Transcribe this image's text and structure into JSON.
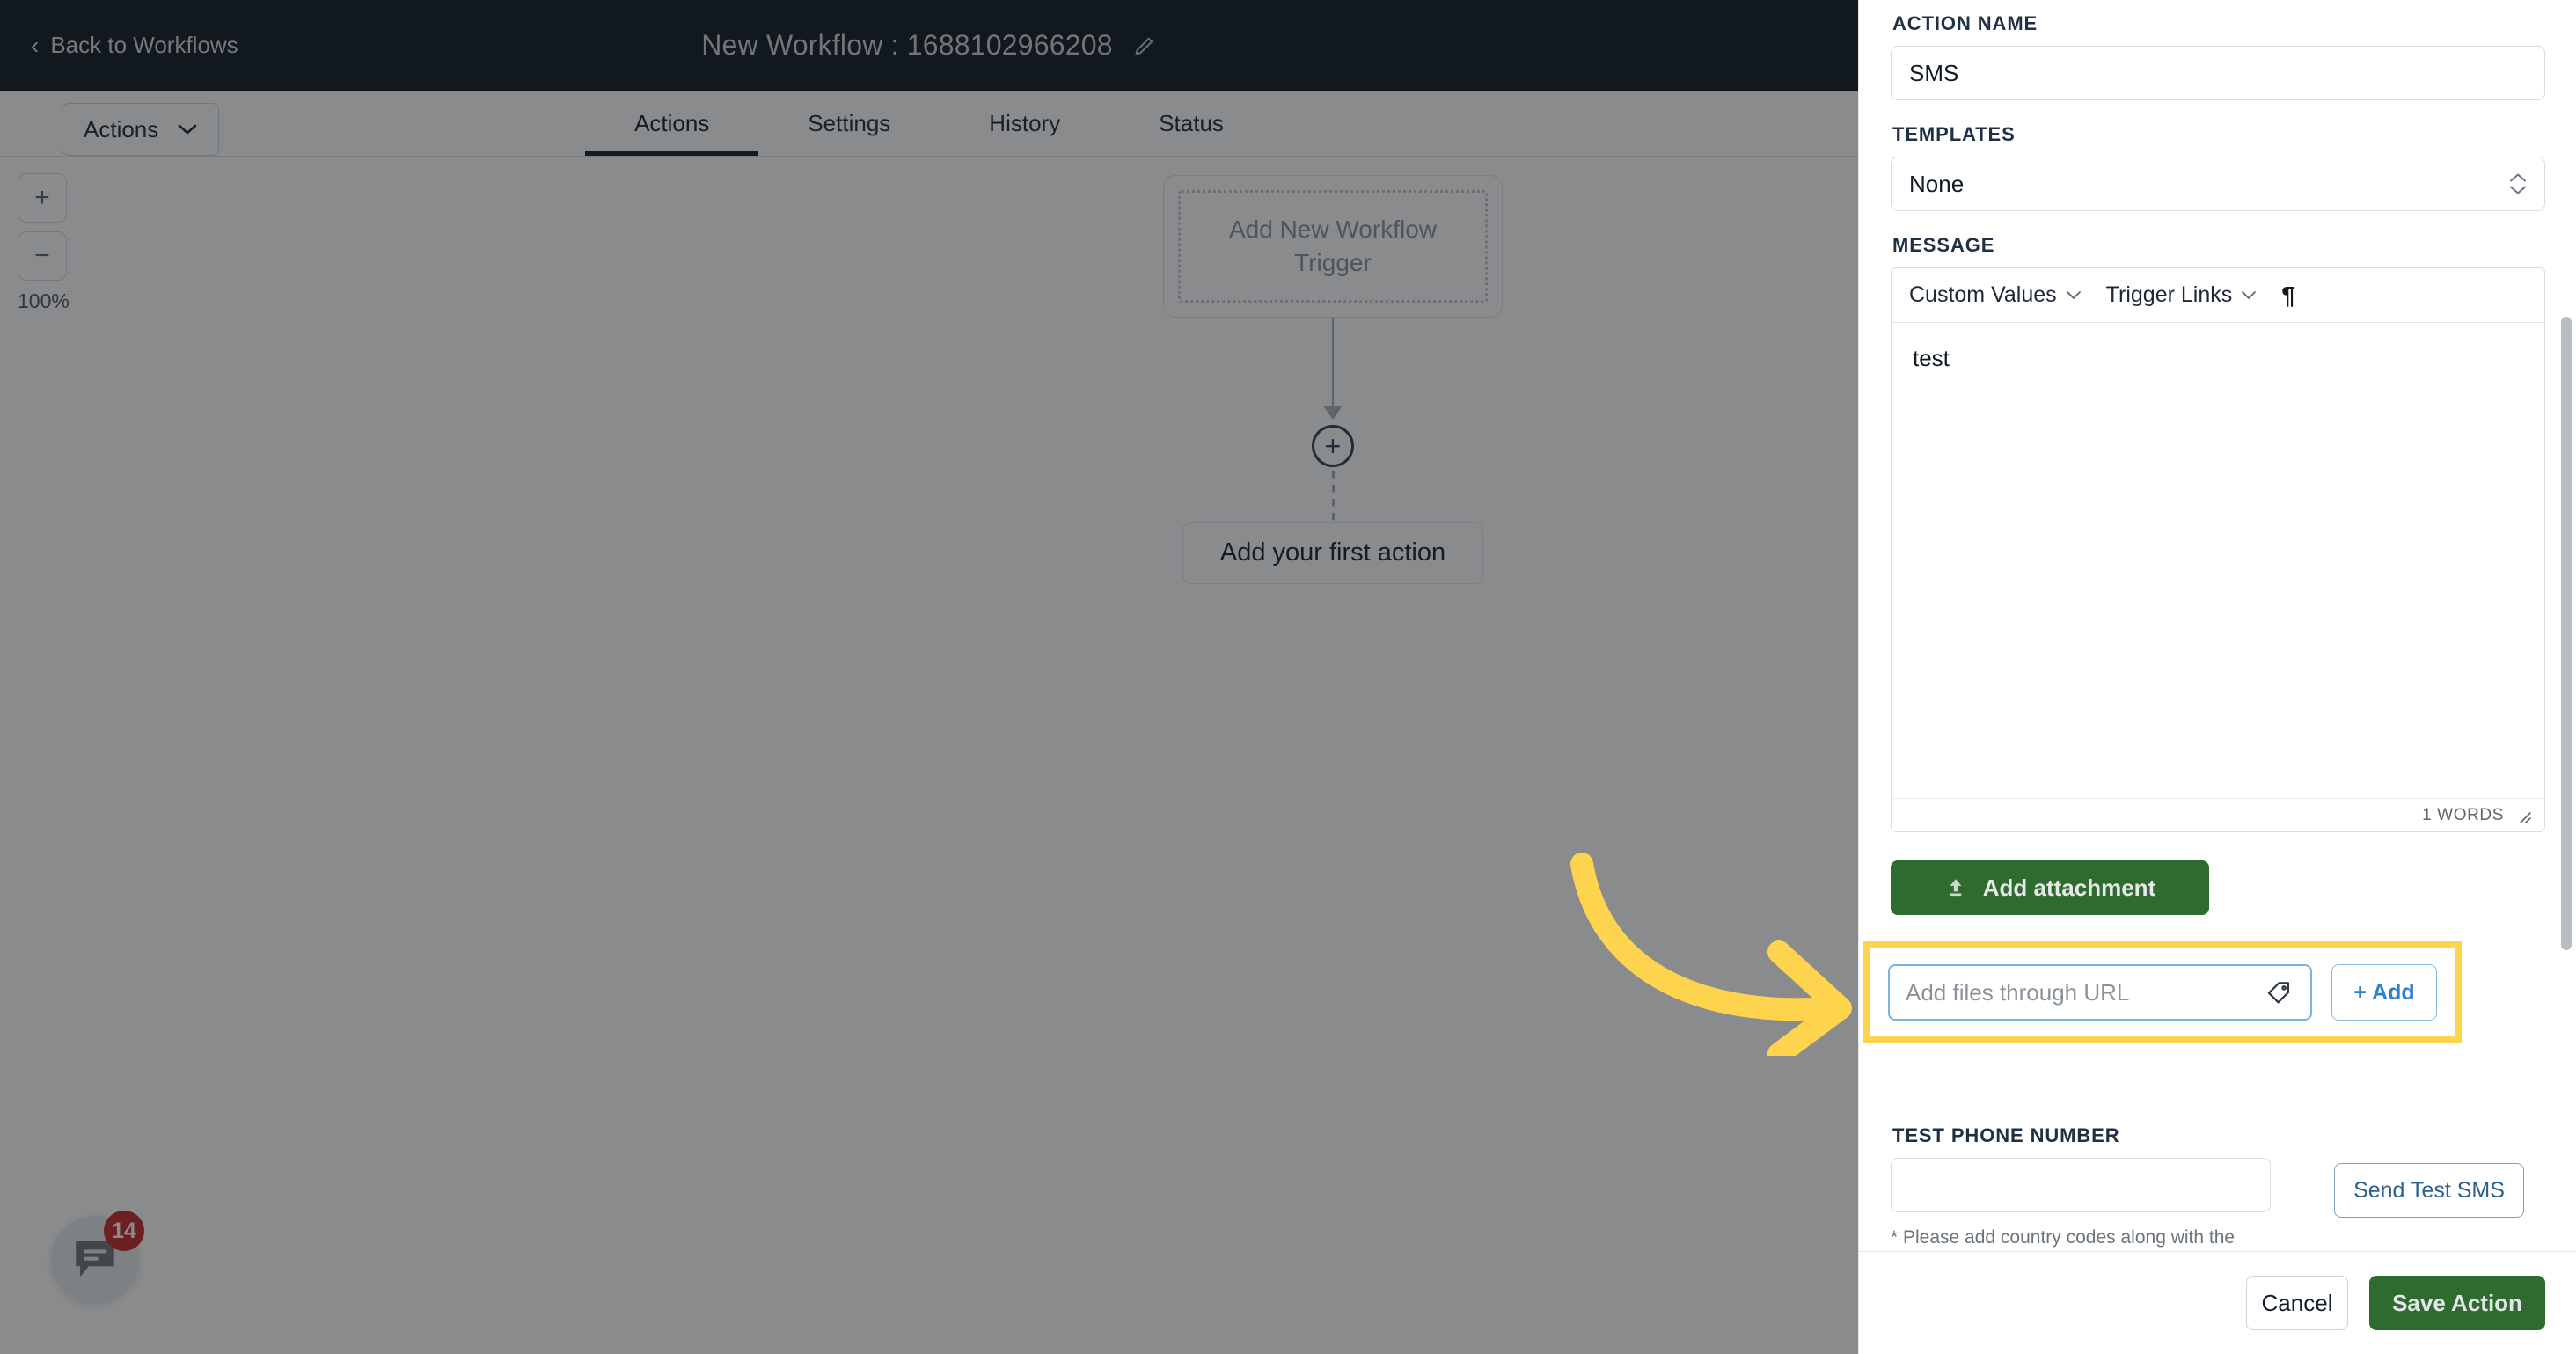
{
  "topbar": {
    "back_label": "Back to Workflows",
    "back_icon": "chevron-left-icon",
    "workflow_title": "New Workflow : 1688102966208",
    "edit_icon": "pencil-icon"
  },
  "tabbar": {
    "actions_dropdown_label": "Actions",
    "actions_dropdown_icon": "chevron-down-icon",
    "tabs": [
      {
        "label": "Actions",
        "active": true
      },
      {
        "label": "Settings",
        "active": false
      },
      {
        "label": "History",
        "active": false
      },
      {
        "label": "Status",
        "active": false
      }
    ]
  },
  "canvas": {
    "zoom_in_label": "+",
    "zoom_out_label": "−",
    "zoom_level": "100%",
    "trigger_card_label": "Add New Workflow Trigger",
    "add_node_label": "+",
    "first_action_label": "Add your first action"
  },
  "chat_widget": {
    "icon": "chat-bubble-icon",
    "badge_count": "14"
  },
  "panel": {
    "action_name": {
      "label": "ACTION NAME",
      "value": "SMS"
    },
    "templates": {
      "label": "TEMPLATES",
      "value": "None",
      "chevron_icon": "chevron-up-down-icon"
    },
    "message": {
      "label": "MESSAGE",
      "toolbar": {
        "custom_values_label": "Custom Values",
        "custom_values_icon": "chevron-down-icon",
        "trigger_links_label": "Trigger Links",
        "trigger_links_icon": "chevron-down-icon",
        "pilcrow_icon": "pilcrow-icon",
        "pilcrow_glyph": "¶"
      },
      "body_text": "test",
      "word_count": "1 WORDS",
      "resize_icon": "resize-grip-icon"
    },
    "attachment": {
      "button_label": "Add attachment",
      "upload_icon": "upload-icon"
    },
    "url_row": {
      "input_placeholder": "Add files through URL",
      "input_value": "",
      "tag_icon": "tag-icon",
      "add_button_label": "+ Add",
      "highlight_color": "#fed34d"
    },
    "test_phone": {
      "label": "TEST PHONE NUMBER",
      "value": "",
      "hint": "* Please add country codes along with the numbers.",
      "send_button_label": "Send Test SMS"
    },
    "footer": {
      "cancel_label": "Cancel",
      "save_label": "Save Action"
    }
  },
  "annotation": {
    "arrow_icon": "curved-arrow-right-icon",
    "arrow_color": "#fed34d"
  }
}
